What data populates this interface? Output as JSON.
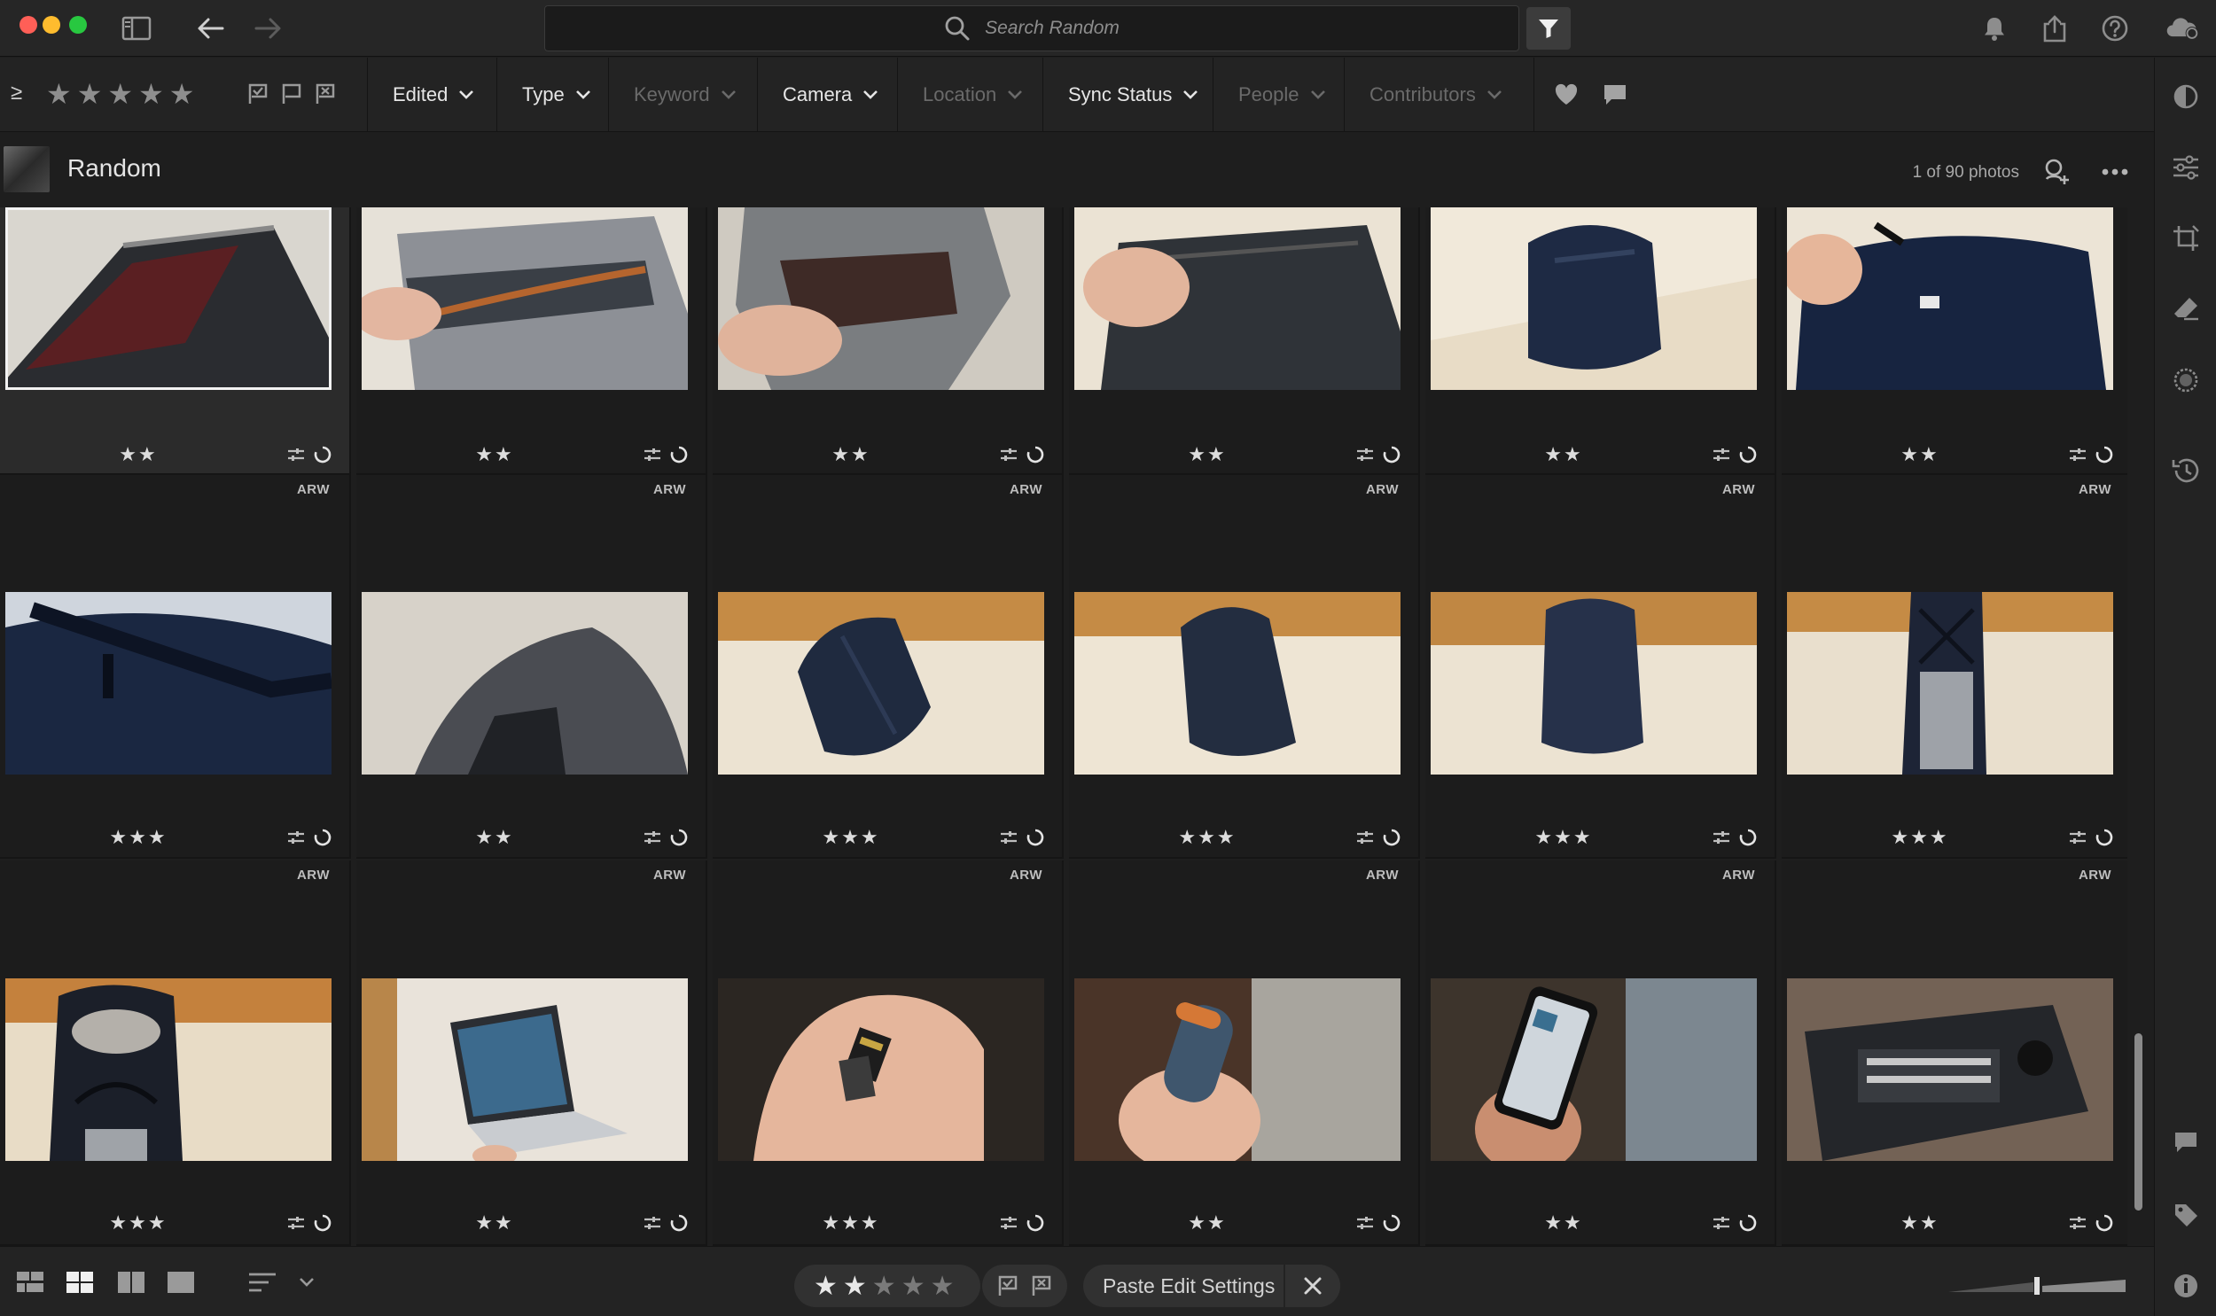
{
  "search": {
    "placeholder": "Search Random"
  },
  "filterbar": {
    "min_rating_symbol": "≥",
    "rating_stars": "★★★★★",
    "dropdowns": [
      {
        "label": "Edited",
        "enabled": true
      },
      {
        "label": "Type",
        "enabled": true
      },
      {
        "label": "Keyword",
        "enabled": false
      },
      {
        "label": "Camera",
        "enabled": true
      },
      {
        "label": "Location",
        "enabled": false
      },
      {
        "label": "Sync Status",
        "enabled": true
      },
      {
        "label": "People",
        "enabled": false
      },
      {
        "label": "Contributors",
        "enabled": false
      }
    ]
  },
  "album": {
    "title": "Random",
    "count": "1 of 90 photos"
  },
  "photos": [
    {
      "rating": "★★",
      "badge": "",
      "scene": "bag-inner-red"
    },
    {
      "rating": "★★",
      "badge": "",
      "scene": "bag-zip-grey"
    },
    {
      "rating": "★★",
      "badge": "",
      "scene": "bag-open-grey"
    },
    {
      "rating": "★★",
      "badge": "",
      "scene": "bag-hand-dark"
    },
    {
      "rating": "★★",
      "badge": "",
      "scene": "bag-navy-couch"
    },
    {
      "rating": "★★",
      "badge": "",
      "scene": "bag-navy-hand"
    },
    {
      "rating": "★★★",
      "badge": "ARW",
      "scene": "bag-strap-navy"
    },
    {
      "rating": "★★",
      "badge": "ARW",
      "scene": "bag-blur-grey"
    },
    {
      "rating": "★★★",
      "badge": "ARW",
      "scene": "backpack-couch-1"
    },
    {
      "rating": "★★★",
      "badge": "ARW",
      "scene": "backpack-couch-2"
    },
    {
      "rating": "★★★",
      "badge": "ARW",
      "scene": "backpack-couch-3"
    },
    {
      "rating": "★★★",
      "badge": "ARW",
      "scene": "backpack-open-couch"
    },
    {
      "rating": "★★★",
      "badge": "ARW",
      "scene": "backpack-open-grey"
    },
    {
      "rating": "★★",
      "badge": "ARW",
      "scene": "laptop-hand"
    },
    {
      "rating": "★★★",
      "badge": "ARW",
      "scene": "cards-palm"
    },
    {
      "rating": "★★",
      "badge": "ARW",
      "scene": "ssd-hand"
    },
    {
      "rating": "★★",
      "badge": "ARW",
      "scene": "phone-hand"
    },
    {
      "rating": "★★",
      "badge": "ARW",
      "scene": "camera-body"
    }
  ],
  "bottombar": {
    "stars_on": "★★",
    "stars_off": "★★★",
    "paste_label": "Paste Edit Settings"
  },
  "colors": {
    "accent": "#f2f2f2",
    "panel": "#232323",
    "grid": "#1c1c1c"
  }
}
